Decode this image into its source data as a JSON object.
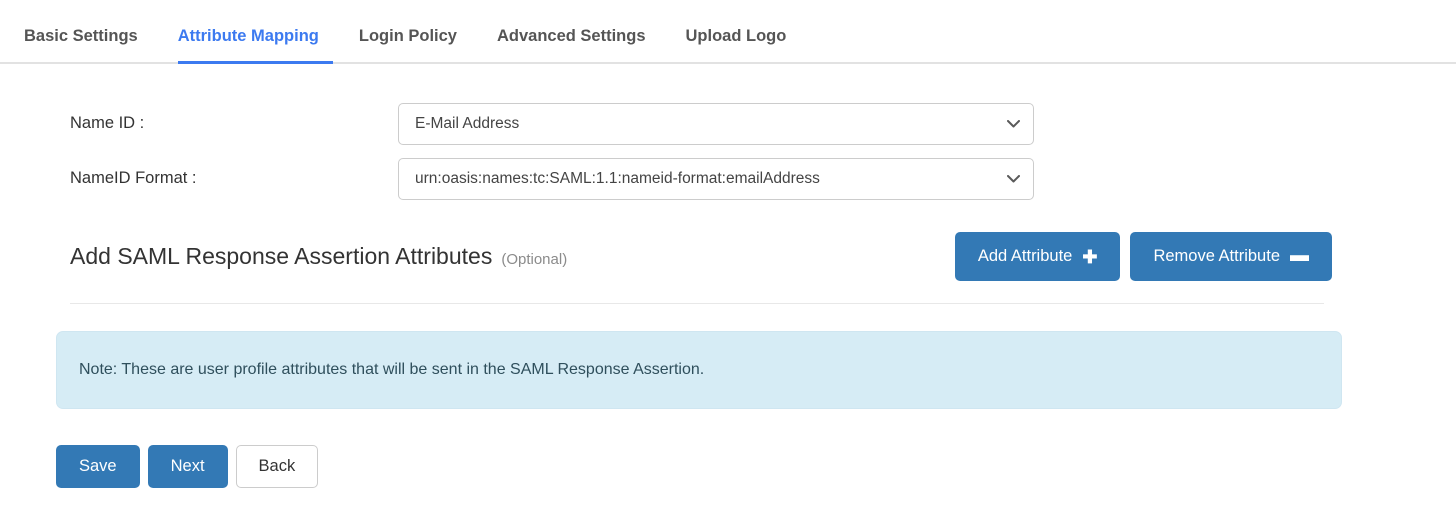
{
  "tabs": [
    {
      "label": "Basic Settings",
      "active": false
    },
    {
      "label": "Attribute Mapping",
      "active": true
    },
    {
      "label": "Login Policy",
      "active": false
    },
    {
      "label": "Advanced Settings",
      "active": false
    },
    {
      "label": "Upload Logo",
      "active": false
    }
  ],
  "form": {
    "name_id": {
      "label": "Name ID :",
      "value": "E-Mail Address"
    },
    "nameid_format": {
      "label": "NameID Format :",
      "value": "urn:oasis:names:tc:SAML:1.1:nameid-format:emailAddress"
    }
  },
  "section": {
    "title": "Add SAML Response Assertion Attributes",
    "optional": "(Optional)",
    "add_attribute_label": "Add Attribute",
    "add_attribute_icon": "plus-icon",
    "add_attribute_glyph": "✚",
    "remove_attribute_label": "Remove Attribute",
    "remove_attribute_icon": "minus-icon",
    "remove_attribute_glyph": "▬"
  },
  "note": {
    "text": "Note: These are user profile attributes that will be sent in the SAML Response Assertion."
  },
  "footer": {
    "save_label": "Save",
    "next_label": "Next",
    "back_label": "Back"
  },
  "colors": {
    "tab_active": "#3c7af0",
    "button_primary": "#3379b5",
    "note_background": "#d6ecf5",
    "tab_inactive_text": "#555555"
  },
  "icons": {
    "chevron_down": "chevron-down-icon"
  }
}
